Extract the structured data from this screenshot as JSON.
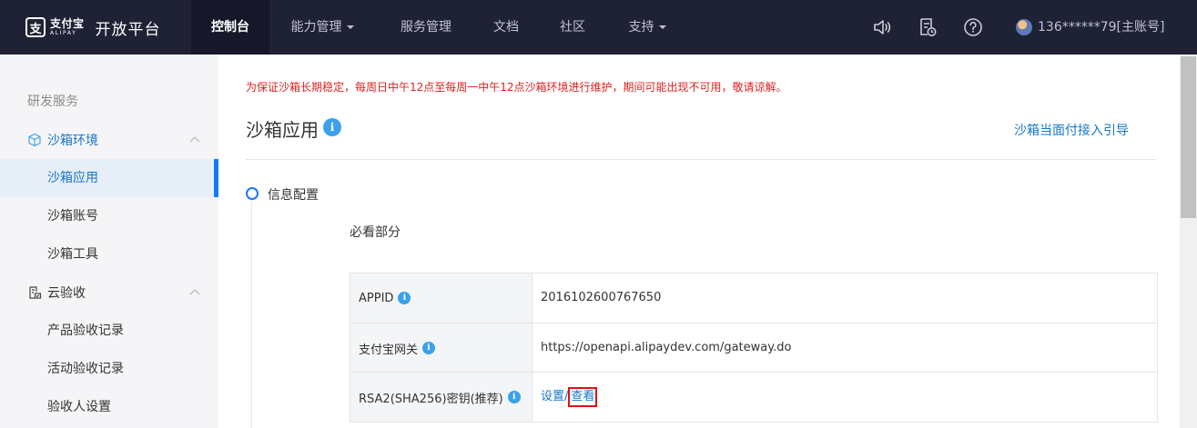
{
  "header": {
    "logo_cn": "支付宝",
    "logo_en": "ALIPAY",
    "platform": "开放平台",
    "nav": [
      {
        "label": "控制台",
        "active": true
      },
      {
        "label": "能力管理",
        "dropdown": true
      },
      {
        "label": "服务管理"
      },
      {
        "label": "文档"
      },
      {
        "label": "社区"
      },
      {
        "label": "支持",
        "dropdown": true
      }
    ],
    "icons": [
      "speaker-icon",
      "notification-doc-icon",
      "help-icon"
    ],
    "account": "136******79[主账号]"
  },
  "sidebar": {
    "section_title": "研发服务",
    "groups": [
      {
        "label": "沙箱环境",
        "icon": "sandbox-cube-icon",
        "expanded": true,
        "items": [
          {
            "label": "沙箱应用",
            "active": true
          },
          {
            "label": "沙箱账号"
          },
          {
            "label": "沙箱工具"
          }
        ]
      },
      {
        "label": "云验收",
        "icon": "cloud-check-icon",
        "expanded": true,
        "items": [
          {
            "label": "产品验收记录"
          },
          {
            "label": "活动验收记录"
          },
          {
            "label": "验收人设置"
          }
        ]
      }
    ]
  },
  "main": {
    "notice": "为保证沙箱长期稳定，每周日中午12点至每周一中午12点沙箱环境进行维护，期间可能出现不可用，敬请谅解。",
    "title": "沙箱应用",
    "guide_link": "沙箱当面付接入引导",
    "step_label": "信息配置",
    "must_read": "必看部分",
    "config_rows": [
      {
        "key": "APPID",
        "value": "2016102600767650"
      },
      {
        "key": "支付宝网关",
        "value": "https://openapi.alipaydev.com/gateway.do"
      },
      {
        "key": "RSA2(SHA256)密钥(推荐)",
        "set_label": "设置",
        "separator": "/",
        "view_label": "查看"
      }
    ]
  },
  "colors": {
    "topbar": "#1f2235",
    "accent": "#1677ff",
    "link": "#1677c8",
    "notice_red": "#e02020",
    "highlight_red": "#e01010",
    "info_blue": "#3aa1ec"
  }
}
